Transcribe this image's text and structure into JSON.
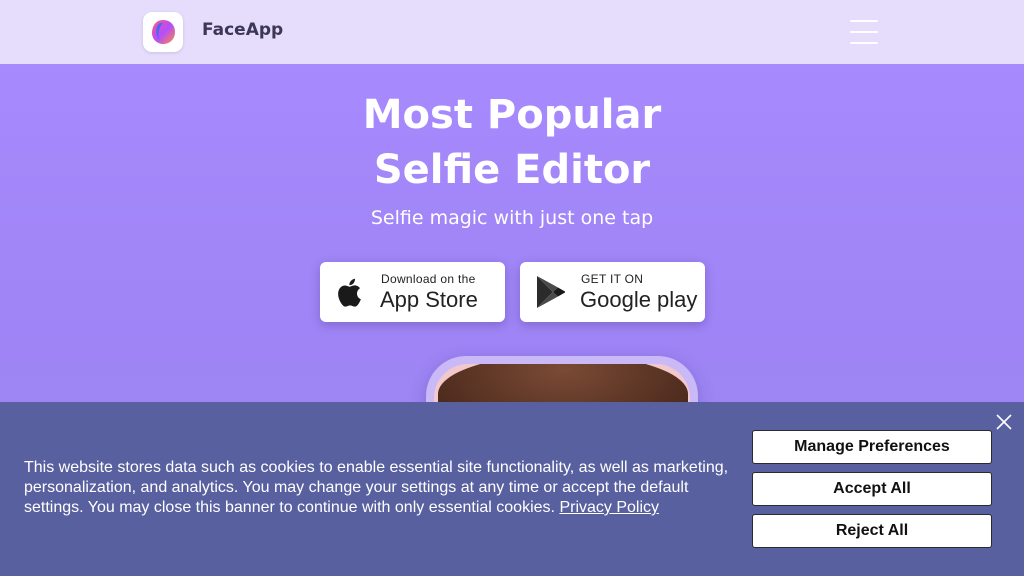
{
  "header": {
    "brand": "FaceApp",
    "logo_icon": "faceapp-logo-icon",
    "menu_icon": "hamburger-menu-icon"
  },
  "hero": {
    "title_line1": "Most Popular",
    "title_line2": "Selfie Editor",
    "subtitle": "Selfie magic with just one tap"
  },
  "store_buttons": {
    "apple": {
      "small": "Download on the",
      "big": "App Store",
      "icon": "apple-icon"
    },
    "google": {
      "small": "GET IT ON",
      "big": "Google play",
      "icon": "google-play-icon"
    }
  },
  "cookie_banner": {
    "text": "This website stores data such as cookies to enable essential site functionality, as well as marketing, personalization, and analytics. You may change your settings at any time or accept the default settings. You may close this banner to continue with only essential cookies.",
    "link": "Privacy Policy",
    "buttons": {
      "manage": "Manage Preferences",
      "accept": "Accept All",
      "reject": "Reject All"
    },
    "close_icon": "close-icon"
  },
  "colors": {
    "header_bg": "#e6dcfb",
    "hero_bg": "#a98bff",
    "banner_bg": "#58609f"
  }
}
